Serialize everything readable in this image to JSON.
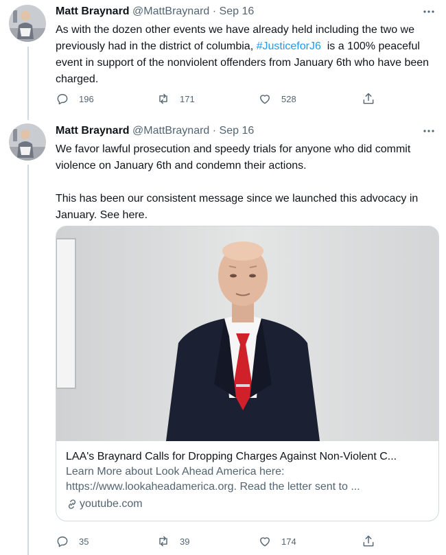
{
  "tweets": [
    {
      "author_name": "Matt Braynard",
      "handle": "@MattBraynard",
      "separator": "·",
      "date": "Sep 16",
      "text_before": "As with the dozen other events we have already held including the two we previously had in the district of columbia, ",
      "hashtag": "#JusticeforJ6",
      "text_after": "  is a 100% peaceful event in support of the nonviolent offenders from January 6th who have been charged.",
      "replies": "196",
      "retweets": "171",
      "likes": "528"
    },
    {
      "author_name": "Matt Braynard",
      "handle": "@MattBraynard",
      "separator": "·",
      "date": "Sep 16",
      "text": "We favor lawful prosecution and speedy trials for anyone who did commit violence on January 6th and condemn their actions.\n\nThis has been our consistent message since we launched this advocacy in January. See here.",
      "card": {
        "title": "LAA's Braynard Calls for Dropping Charges Against Non-Violent C...",
        "description": "Learn More about Look Ahead America here: https://www.lookaheadamerica.org. Read the letter sent to ...",
        "domain": "youtube.com"
      },
      "replies": "35",
      "retweets": "39",
      "likes": "174"
    }
  ],
  "icons": {
    "more": "more-horizontal-icon",
    "reply": "reply-icon",
    "retweet": "retweet-icon",
    "like": "heart-icon",
    "share": "share-icon",
    "link": "link-icon"
  },
  "colors": {
    "hashtag": "#1d9bf0",
    "secondary_text": "#536471",
    "border": "#cfd9de",
    "tie": "#d0202a",
    "suit": "#1c2033"
  }
}
